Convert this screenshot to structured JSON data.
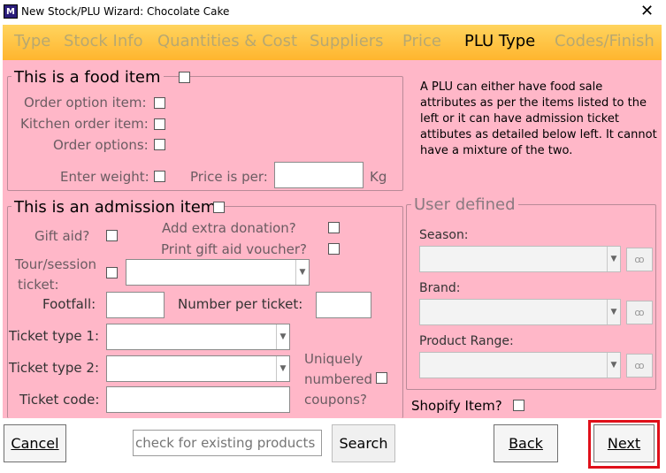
{
  "window": {
    "title": "New Stock/PLU Wizard: Chocolate Cake",
    "icon_text": "M"
  },
  "tabs": [
    {
      "label": "Type"
    },
    {
      "label": "Stock Info"
    },
    {
      "label": "Quantities & Cost"
    },
    {
      "label": "Suppliers"
    },
    {
      "label": "Price"
    },
    {
      "label": "PLU Type"
    },
    {
      "label": "Codes/Finish"
    }
  ],
  "food": {
    "title": "This is a food item",
    "order_option": "Order option item:",
    "kitchen_order": "Kitchen order item:",
    "order_options": "Order options:",
    "enter_weight": "Enter weight:",
    "price_per": "Price is per:",
    "price_unit": "Kg"
  },
  "info_text": "A PLU can either have food sale attributes as per the items listed to the left or it can have admission  ticket attibutes as detailed below left.  It cannot have a mixture of the two.",
  "admission": {
    "title": "This is an admission item",
    "gift_aid": "Gift aid?",
    "add_donation": "Add extra donation?",
    "print_voucher": "Print gift aid voucher?",
    "tour_session_1": "Tour/session",
    "tour_session_2": "ticket:",
    "footfall": "Footfall:",
    "number_per_ticket": "Number per ticket:",
    "ticket_type_1": "Ticket type 1:",
    "ticket_type_2": "Ticket type 2:",
    "ticket_code": "Ticket code:",
    "uniquely_1": "Uniquely",
    "uniquely_2": "numbered",
    "uniquely_3": "coupons?"
  },
  "user_defined": {
    "title": "User defined",
    "season": "Season:",
    "brand": "Brand:",
    "product_range": "Product Range:"
  },
  "shopify": "Shopify Item?",
  "bottom": {
    "cancel": "Cancel",
    "search_placeholder": "check for existing products",
    "search": "Search",
    "back": "Back",
    "next": "Next"
  },
  "icons": {
    "app": "app-logo-icon",
    "close": "close-icon",
    "dropdown": "chevron-down-icon",
    "lookup": "binoculars-icon"
  }
}
